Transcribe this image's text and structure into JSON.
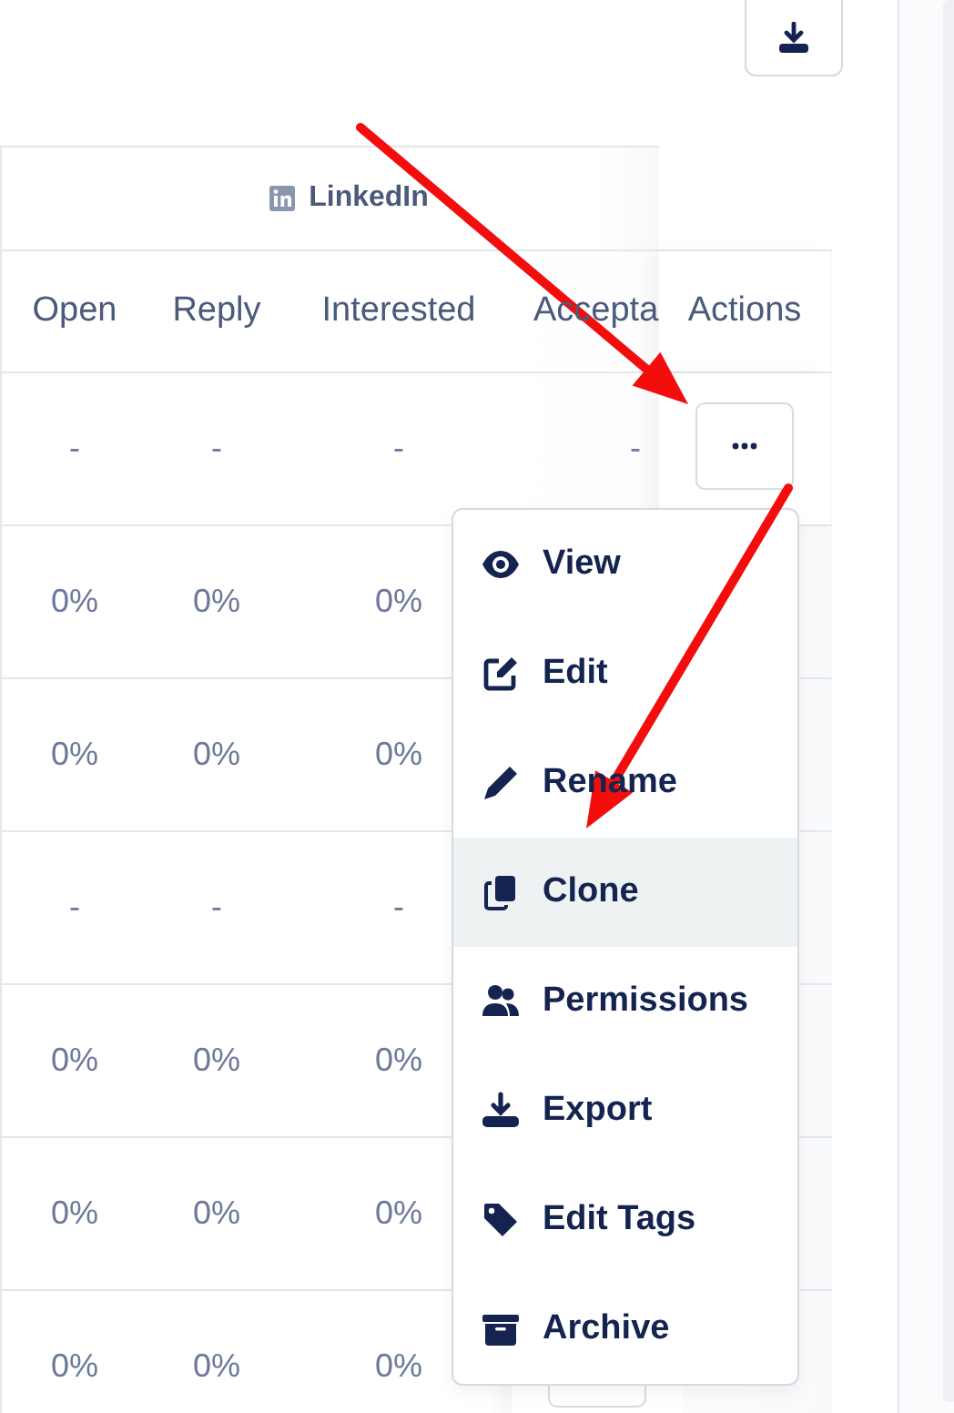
{
  "table": {
    "group_header": "LinkedIn",
    "columns": [
      "Open",
      "Reply",
      "Interested",
      "Accepta",
      "Actions"
    ],
    "rows": [
      {
        "cells": [
          "-",
          "-",
          "-",
          "-"
        ]
      },
      {
        "cells": [
          "0%",
          "0%",
          "0%"
        ]
      },
      {
        "cells": [
          "0%",
          "0%",
          "0%"
        ]
      },
      {
        "cells": [
          "-",
          "-",
          "-"
        ]
      },
      {
        "cells": [
          "0%",
          "0%",
          "0%"
        ]
      },
      {
        "cells": [
          "0%",
          "0%",
          "0%"
        ]
      },
      {
        "cells": [
          "0%",
          "0%",
          "0%"
        ]
      }
    ]
  },
  "menu": {
    "items": [
      {
        "label": "View",
        "selected": false
      },
      {
        "label": "Edit",
        "selected": false
      },
      {
        "label": "Rename",
        "selected": false
      },
      {
        "label": "Clone",
        "selected": true
      },
      {
        "label": "Permissions",
        "selected": false
      },
      {
        "label": "Export",
        "selected": false
      },
      {
        "label": "Edit Tags",
        "selected": false
      },
      {
        "label": "Archive",
        "selected": false
      }
    ]
  }
}
